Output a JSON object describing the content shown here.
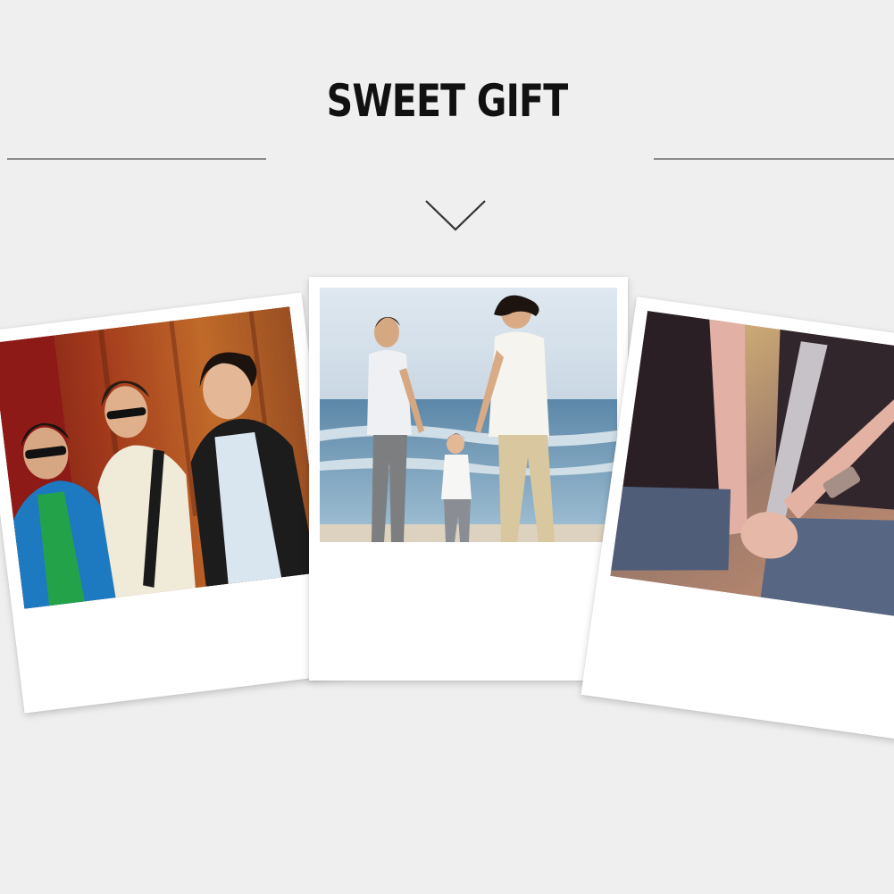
{
  "title": "SWEET GIFT",
  "colors": {
    "background": "#efefef",
    "title": "#111111",
    "divider": "#8a8a8a",
    "frame": "#ffffff"
  },
  "icons": {
    "chevron": "chevron-down-icon"
  },
  "photos": [
    {
      "scene": "three-young-men"
    },
    {
      "scene": "family-beach-walk"
    },
    {
      "scene": "couple-holding-hands"
    }
  ]
}
